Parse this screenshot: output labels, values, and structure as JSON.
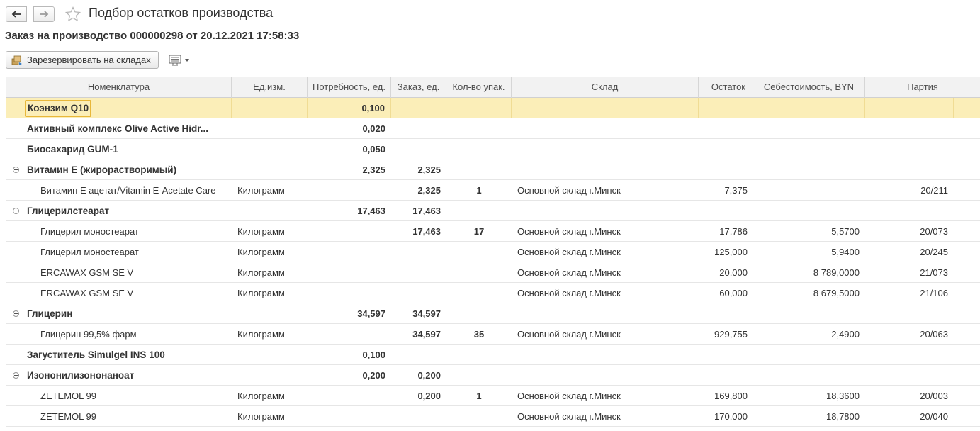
{
  "window": {
    "title": "Подбор остатков производства",
    "subtitle": "Заказ на производство 000000298 от 20.12.2021 17:58:33"
  },
  "toolbar": {
    "reserve_label": "Зарезервировать на складах"
  },
  "table": {
    "headers": {
      "nomenclature": "Номенклатура",
      "unit": "Ед.изм.",
      "need": "Потребность, ед.",
      "order": "Заказ, ед.",
      "packs": "Кол-во упак.",
      "warehouse": "Склад",
      "balance": "Остаток",
      "cost": "Себестоимость, BYN",
      "batch": "Партия"
    },
    "rows": [
      {
        "level": 0,
        "expandable": false,
        "selected": true,
        "name": "Коэнзим Q10",
        "unit": "",
        "need": "0,100",
        "order": "",
        "packs": "",
        "warehouse": "",
        "balance": "",
        "cost": "",
        "batch": ""
      },
      {
        "level": 0,
        "expandable": false,
        "name": "Активный комплекс Olive Active Hidr...",
        "unit": "",
        "need": "0,020",
        "order": "",
        "packs": "",
        "warehouse": "",
        "balance": "",
        "cost": "",
        "batch": ""
      },
      {
        "level": 0,
        "expandable": false,
        "name": "Биосахарид GUM-1",
        "unit": "",
        "need": "0,050",
        "order": "",
        "packs": "",
        "warehouse": "",
        "balance": "",
        "cost": "",
        "batch": ""
      },
      {
        "level": 0,
        "expandable": true,
        "name": "Витамин Е (жирорастворимый)",
        "unit": "",
        "need": "2,325",
        "order": "2,325",
        "packs": "",
        "warehouse": "",
        "balance": "",
        "cost": "",
        "batch": ""
      },
      {
        "level": 1,
        "name": "Витамин Е ацетат/Vitamin E-Acetate Care",
        "unit": "Килограмм",
        "need": "",
        "order": "2,325",
        "packs": "1",
        "warehouse": "Основной склад г.Минск",
        "balance": "7,375",
        "cost": "",
        "batch": "20/211"
      },
      {
        "level": 0,
        "expandable": true,
        "name": "Глицерилстеарат",
        "unit": "",
        "need": "17,463",
        "order": "17,463",
        "packs": "",
        "warehouse": "",
        "balance": "",
        "cost": "",
        "batch": ""
      },
      {
        "level": 1,
        "name": "Глицерил моностеарат",
        "unit": "Килограмм",
        "need": "",
        "order": "17,463",
        "packs": "17",
        "warehouse": "Основной склад г.Минск",
        "balance": "17,786",
        "cost": "5,5700",
        "batch": "20/073"
      },
      {
        "level": 1,
        "name": "Глицерил моностеарат",
        "unit": "Килограмм",
        "need": "",
        "order": "",
        "packs": "",
        "warehouse": "Основной склад г.Минск",
        "balance": "125,000",
        "cost": "5,9400",
        "batch": "20/245"
      },
      {
        "level": 1,
        "name": "ERCAWAX GSM SE V",
        "unit": "Килограмм",
        "need": "",
        "order": "",
        "packs": "",
        "warehouse": "Основной склад г.Минск",
        "balance": "20,000",
        "cost": "8 789,0000",
        "batch": "21/073"
      },
      {
        "level": 1,
        "name": "ERCAWAX GSM SE V",
        "unit": "Килограмм",
        "need": "",
        "order": "",
        "packs": "",
        "warehouse": "Основной склад г.Минск",
        "balance": "60,000",
        "cost": "8 679,5000",
        "batch": "21/106"
      },
      {
        "level": 0,
        "expandable": true,
        "name": "Глицерин",
        "unit": "",
        "need": "34,597",
        "order": "34,597",
        "packs": "",
        "warehouse": "",
        "balance": "",
        "cost": "",
        "batch": ""
      },
      {
        "level": 1,
        "name": "Глицерин 99,5% фарм",
        "unit": "Килограмм",
        "need": "",
        "order": "34,597",
        "packs": "35",
        "warehouse": "Основной склад г.Минск",
        "balance": "929,755",
        "cost": "2,4900",
        "batch": "20/063"
      },
      {
        "level": 0,
        "expandable": false,
        "name": "Загуститель Simulgel INS 100",
        "unit": "",
        "need": "0,100",
        "order": "",
        "packs": "",
        "warehouse": "",
        "balance": "",
        "cost": "",
        "batch": ""
      },
      {
        "level": 0,
        "expandable": true,
        "name": "Изононилизононаноат",
        "unit": "",
        "need": "0,200",
        "order": "0,200",
        "packs": "",
        "warehouse": "",
        "balance": "",
        "cost": "",
        "batch": ""
      },
      {
        "level": 1,
        "name": "ZETEMOL 99",
        "unit": "Килограмм",
        "need": "",
        "order": "0,200",
        "packs": "1",
        "warehouse": "Основной склад г.Минск",
        "balance": "169,800",
        "cost": "18,3600",
        "batch": "20/003"
      },
      {
        "level": 1,
        "name": "ZETEMOL 99",
        "unit": "Килограмм",
        "need": "",
        "order": "",
        "packs": "",
        "warehouse": "Основной склад г.Минск",
        "balance": "170,000",
        "cost": "18,7800",
        "batch": "20/040"
      }
    ]
  },
  "icons": {
    "back": "arrow-left-icon",
    "forward": "arrow-right-icon",
    "favorite": "star-icon",
    "reserve": "warehouse-reserve-icon",
    "more": "list-options-icon",
    "group_toggle": "collapse-minus-icon"
  },
  "colors": {
    "selected_row": "#fbeeb8",
    "focus_border": "#e8b73a",
    "header_bg": "#f2f2f2"
  }
}
